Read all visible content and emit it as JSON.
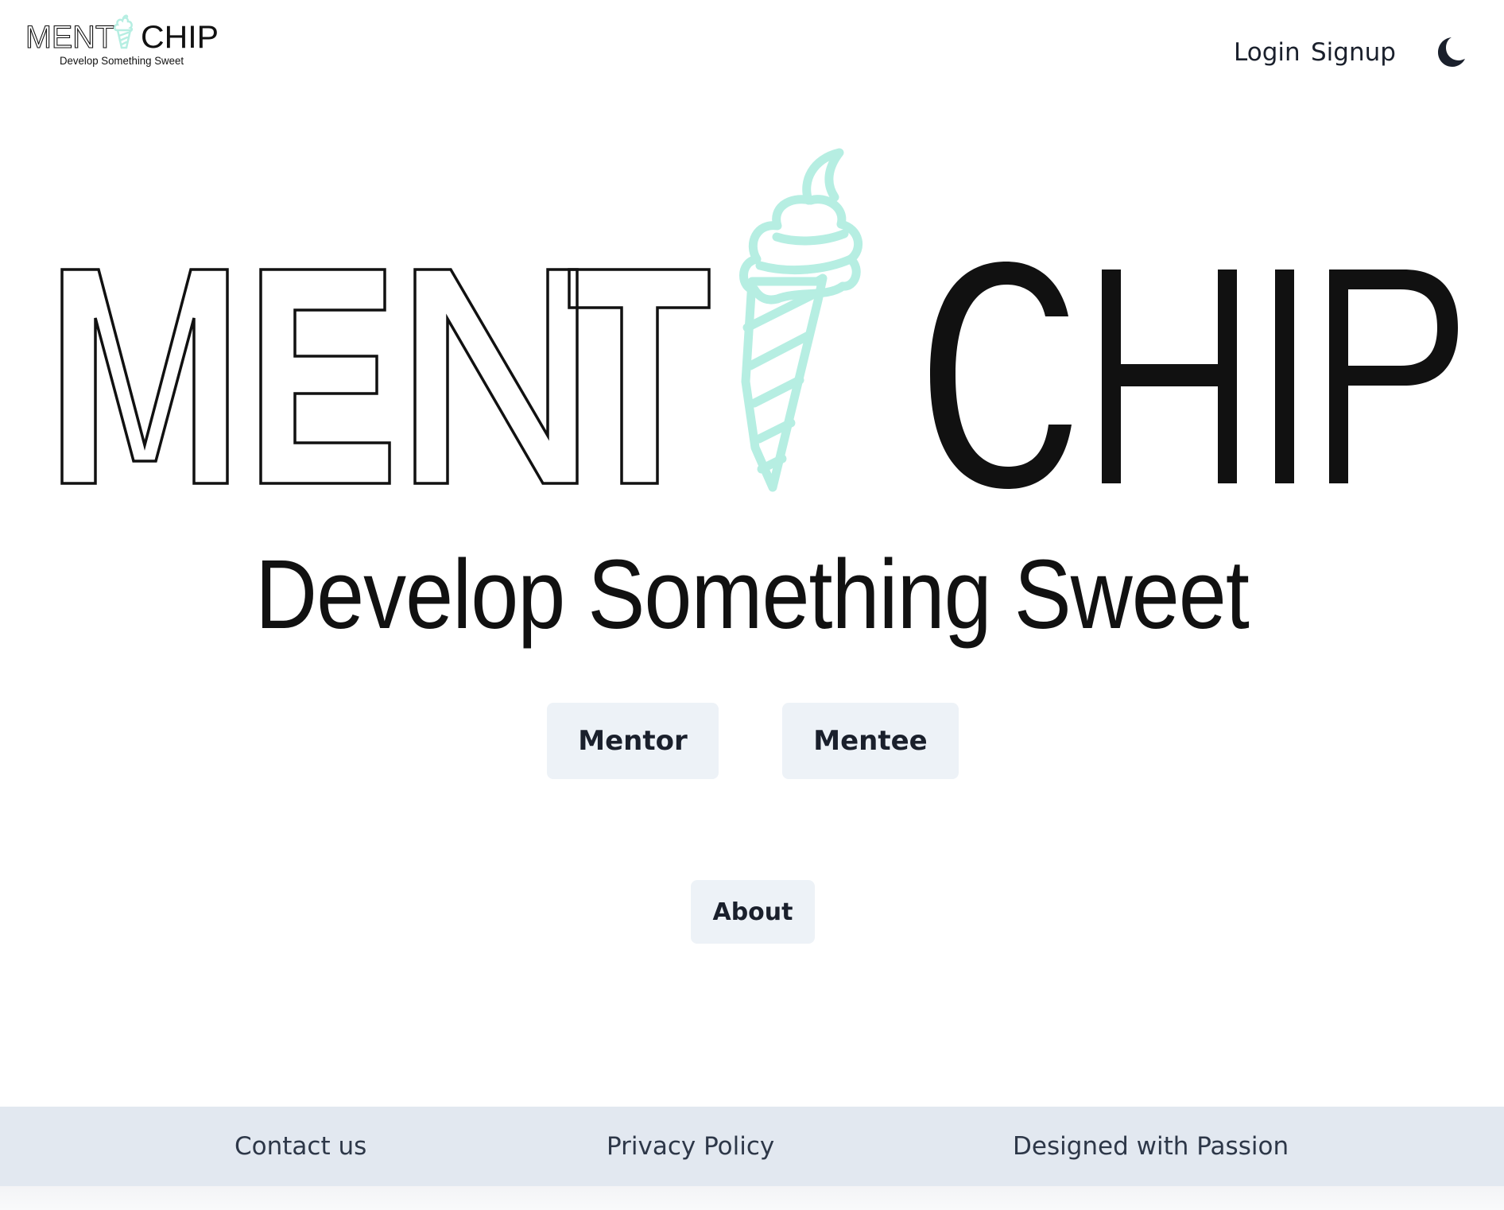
{
  "brand": {
    "name_outline": "MENT",
    "name_solid": "CHIP",
    "tagline": "Develop Something Sweet",
    "accent_color": "#b6eee2",
    "text_color": "#111111"
  },
  "header": {
    "nav": {
      "login": "Login",
      "signup": "Signup"
    },
    "theme_toggle_icon": "moon-icon"
  },
  "hero": {
    "tagline": "Develop Something Sweet"
  },
  "actions": {
    "mentor": "Mentor",
    "mentee": "Mentee",
    "about": "About"
  },
  "footer": {
    "contact": "Contact us",
    "privacy": "Privacy Policy",
    "passion": "Designed with Passion"
  },
  "colors": {
    "button_bg": "#edf2f7",
    "footer_bg": "#e2e8f0",
    "text_dark": "#1a202c"
  }
}
